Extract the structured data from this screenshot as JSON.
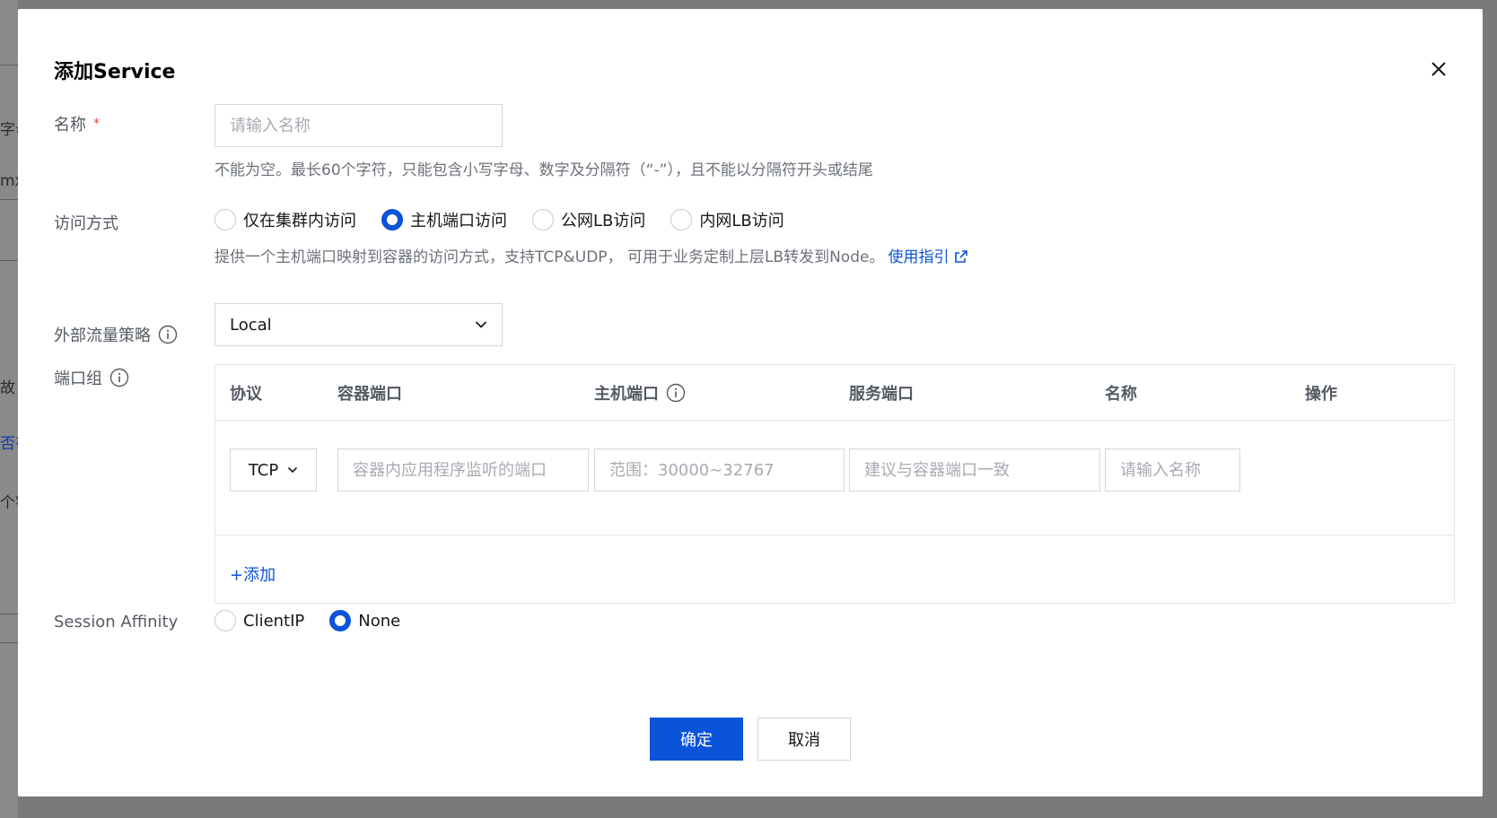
{
  "background": {
    "fragments": [
      "字母",
      "mx",
      "故；",
      "否有",
      "个字"
    ]
  },
  "modal": {
    "title": "添加Service",
    "close_icon": "close-icon"
  },
  "form": {
    "name": {
      "label": "名称",
      "required_mark": "*",
      "placeholder": "请输入名称",
      "value": "",
      "help": "不能为空。最长60个字符，只能包含小写字母、数字及分隔符（“-”），且不能以分隔符开头或结尾"
    },
    "access": {
      "label": "访问方式",
      "options": [
        {
          "label": "仅在集群内访问",
          "checked": false
        },
        {
          "label": "主机端口访问",
          "checked": true
        },
        {
          "label": "公网LB访问",
          "checked": false
        },
        {
          "label": "内网LB访问",
          "checked": false
        }
      ],
      "help": "提供一个主机端口映射到容器的访问方式，支持TCP&UDP， 可用于业务定制上层LB转发到Node。",
      "help_link": "使用指引",
      "link_icon": "external-link-icon"
    },
    "traffic_policy": {
      "label": "外部流量策略",
      "info_icon": "info-icon",
      "value": "Local",
      "dropdown_icon": "chevron-down-icon"
    },
    "port_group": {
      "label": "端口组",
      "info_icon": "info-icon",
      "headers": {
        "protocol": "协议",
        "container_port": "容器端口",
        "host_port": "主机端口",
        "service_port": "服务端口",
        "name": "名称",
        "action": "操作"
      },
      "rows": [
        {
          "protocol": "TCP",
          "container_port_placeholder": "容器内应用程序监听的端口",
          "host_port_placeholder": "范围：30000~32767",
          "service_port_placeholder": "建议与容器端口一致",
          "name_placeholder": "请输入名称"
        }
      ],
      "add_label": "+添加"
    },
    "session_affinity": {
      "label": "Session Affinity",
      "options": [
        {
          "label": "ClientIP",
          "checked": false
        },
        {
          "label": "None",
          "checked": true
        }
      ]
    }
  },
  "footer": {
    "confirm_label": "确定",
    "cancel_label": "取消"
  },
  "colors": {
    "primary": "#0b53d9",
    "required": "#e54545",
    "border": "#d4d6da"
  }
}
